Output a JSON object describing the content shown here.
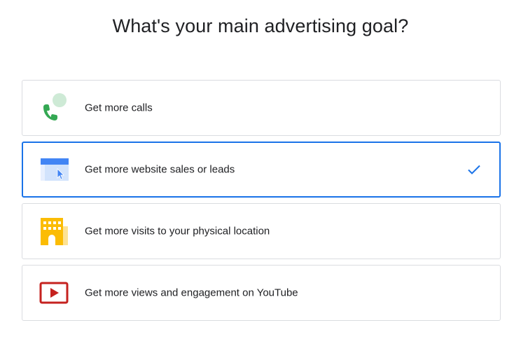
{
  "page": {
    "title": "What's your main advertising goal?"
  },
  "options": [
    {
      "label": "Get more calls",
      "icon": "phone-call-icon",
      "selected": false
    },
    {
      "label": "Get more website sales or leads",
      "icon": "website-cursor-icon",
      "selected": true
    },
    {
      "label": "Get more visits to your physical location",
      "icon": "store-building-icon",
      "selected": false
    },
    {
      "label": "Get more views and engagement on YouTube",
      "icon": "youtube-play-icon",
      "selected": false
    }
  ],
  "colors": {
    "selected_border": "#1a73e8",
    "border": "#dadce0",
    "check": "#1a73e8",
    "phone_green": "#34a853",
    "bubble_green": "#ceead6",
    "browser_blue": "#4285f4",
    "browser_light": "#d2e3fc",
    "building_yellow": "#fbbc04",
    "youtube_red": "#c5221f"
  }
}
